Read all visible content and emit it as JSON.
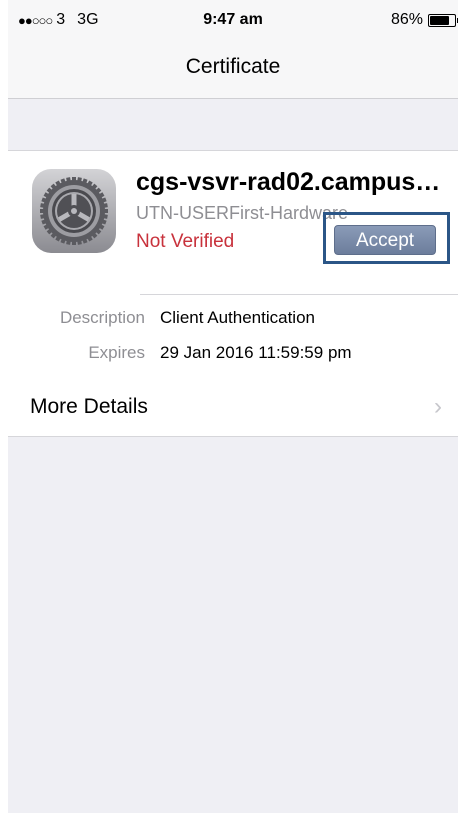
{
  "status_bar": {
    "signal_dots": "●●○○○",
    "carrier": "3",
    "network": "3G",
    "time": "9:47 am",
    "battery_percent": "86%",
    "battery_level": 0.86
  },
  "nav": {
    "title": "Certificate"
  },
  "certificate": {
    "name": "cgs-vsvr-rad02.campus…",
    "issuer": "UTN-USERFirst-Hardware",
    "verification_status": "Not Verified",
    "accept_label": "Accept",
    "icon": "settings-gear-icon"
  },
  "details": [
    {
      "label": "Description",
      "value": "Client Authentication"
    },
    {
      "label": "Expires",
      "value": "29 Jan 2016 11:59:59 pm"
    }
  ],
  "more_details": {
    "label": "More Details",
    "chevron": "›"
  },
  "colors": {
    "not_verified": "#c8323c",
    "accept_button": "#7a8bab",
    "highlight_frame": "#2b5687"
  }
}
